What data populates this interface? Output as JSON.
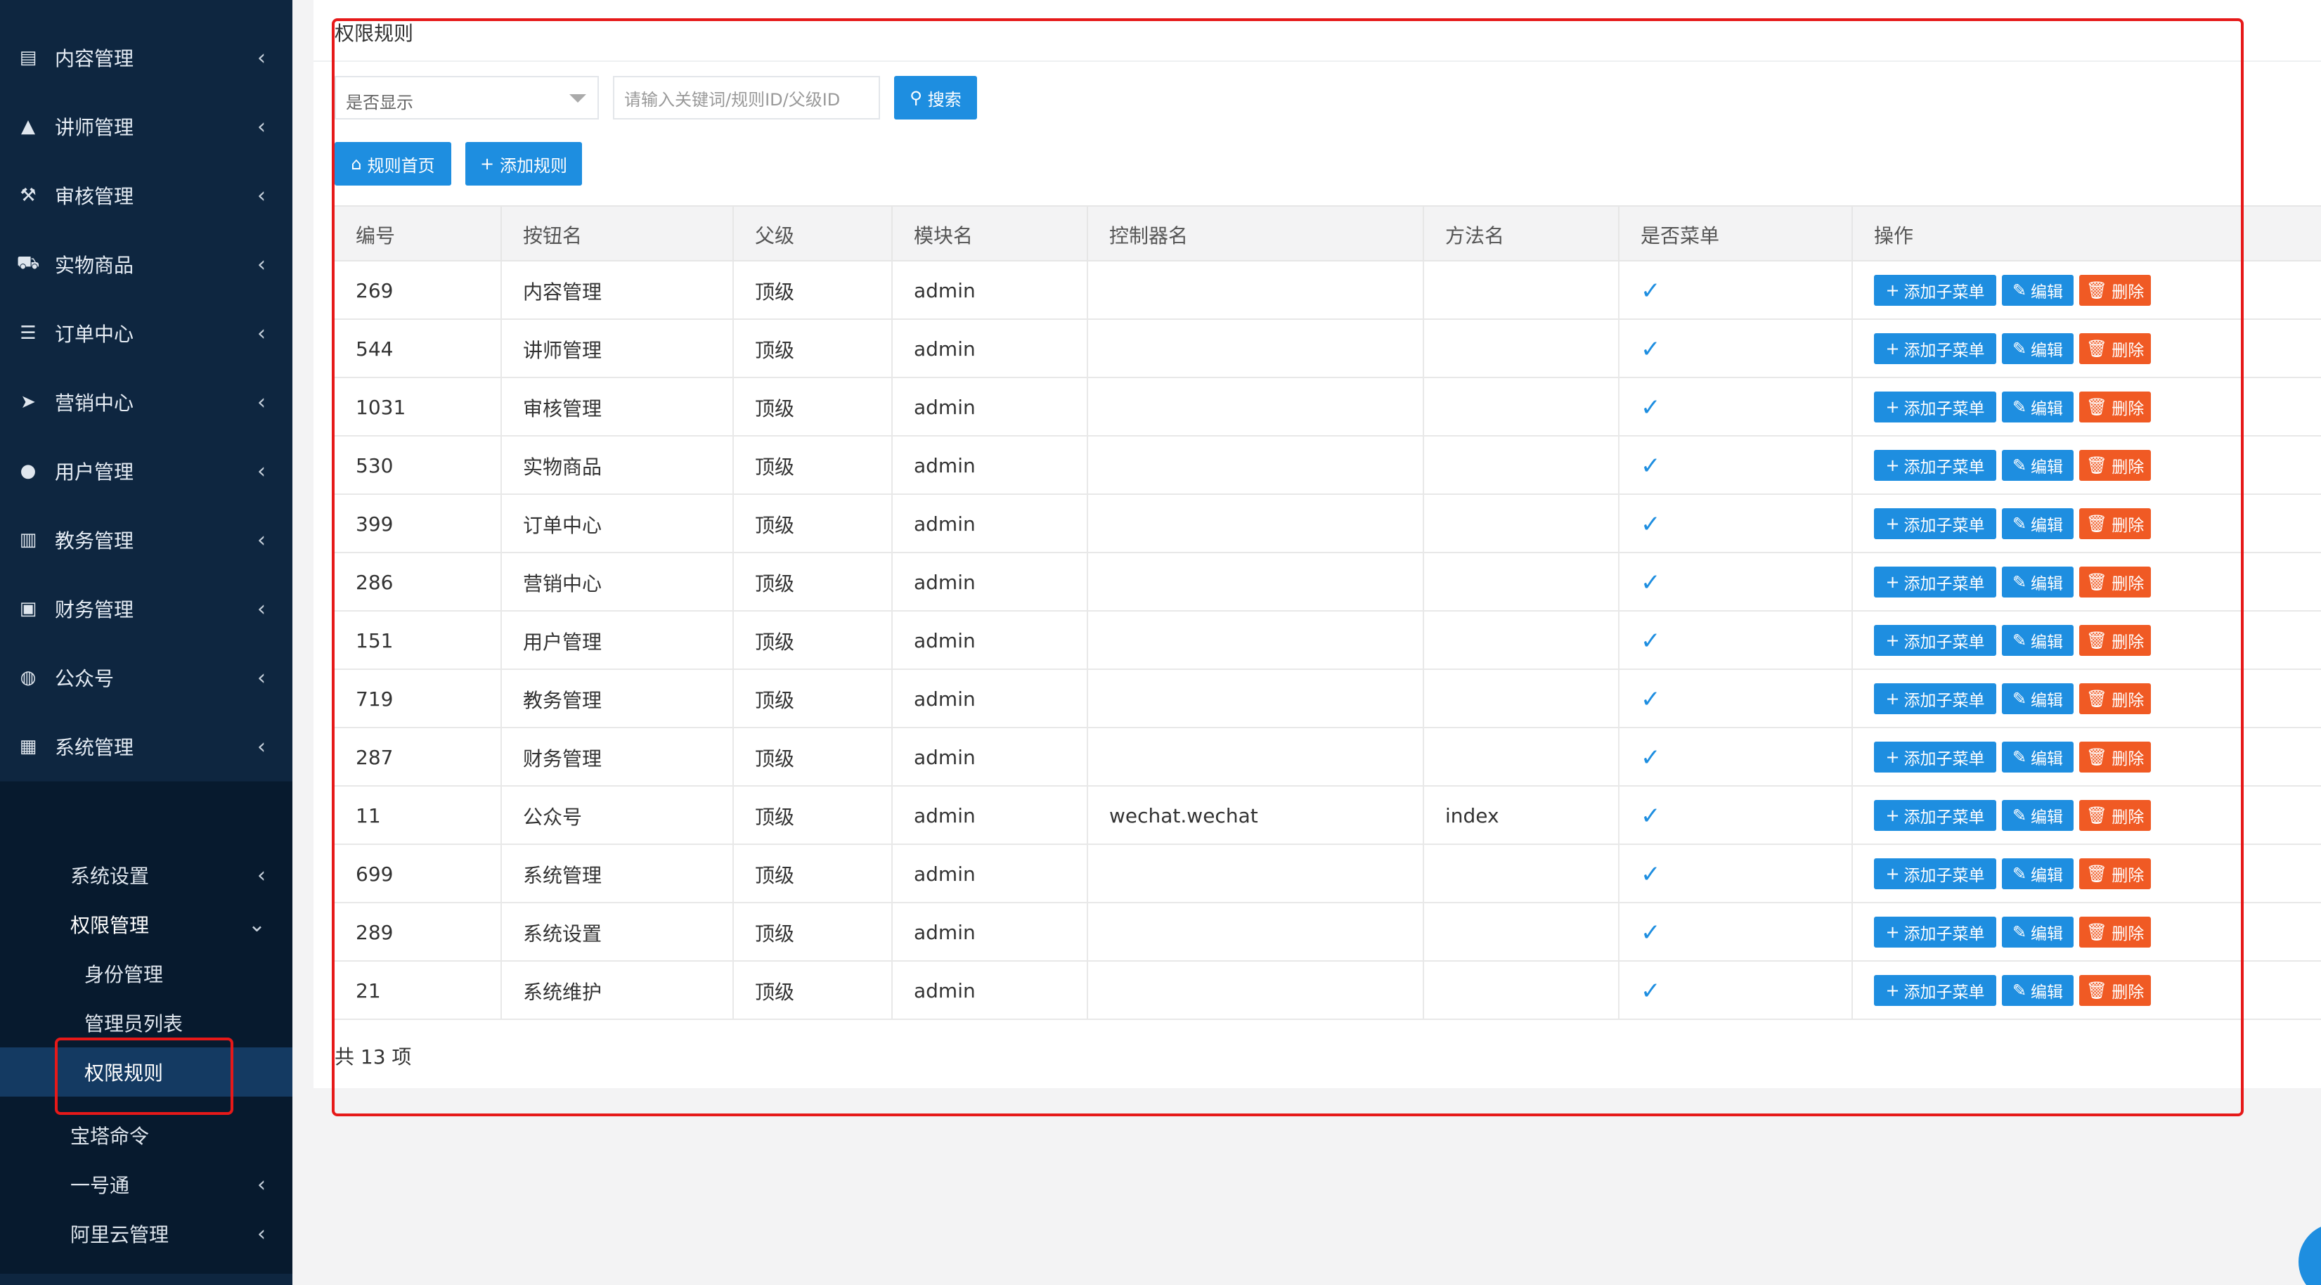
{
  "sidebar": {
    "items": [
      {
        "label": "内容管理",
        "icon": "newspaper-icon"
      },
      {
        "label": "讲师管理",
        "icon": "graduation-cap-icon"
      },
      {
        "label": "审核管理",
        "icon": "gavel-icon"
      },
      {
        "label": "实物商品",
        "icon": "cart-icon"
      },
      {
        "label": "订单中心",
        "icon": "list-icon"
      },
      {
        "label": "营销中心",
        "icon": "paper-plane-icon"
      },
      {
        "label": "用户管理",
        "icon": "user-icon"
      },
      {
        "label": "教务管理",
        "icon": "book-icon"
      },
      {
        "label": "财务管理",
        "icon": "money-icon"
      },
      {
        "label": "公众号",
        "icon": "wechat-icon"
      },
      {
        "label": "系统管理",
        "icon": "grid-icon"
      },
      {
        "label": "系统设置",
        "icon": "gear-icon"
      }
    ],
    "submenu": [
      {
        "label": "系统设置"
      },
      {
        "label": "权限管理"
      },
      {
        "label": "身份管理"
      },
      {
        "label": "管理员列表"
      },
      {
        "label": "权限规则"
      },
      {
        "label": "宝塔命令"
      },
      {
        "label": "一号通"
      },
      {
        "label": "阿里云管理"
      }
    ]
  },
  "card": {
    "title": "权限规则"
  },
  "filters": {
    "select_value": "是否显示",
    "search_placeholder": "请输入关键词/规则ID/父级ID",
    "search_label": "搜索"
  },
  "toolbar": {
    "home_label": "规则首页",
    "add_label": "添加规则"
  },
  "table": {
    "headers": [
      "编号",
      "按钮名",
      "父级",
      "模块名",
      "控制器名",
      "方法名",
      "是否菜单",
      "操作"
    ],
    "actions": {
      "add_child": "添加子菜单",
      "edit": "编辑",
      "delete": "删除"
    },
    "rows": [
      {
        "id": "269",
        "name": "内容管理",
        "parent": "顶级",
        "module": "admin",
        "controller": "",
        "method": ""
      },
      {
        "id": "544",
        "name": "讲师管理",
        "parent": "顶级",
        "module": "admin",
        "controller": "",
        "method": ""
      },
      {
        "id": "1031",
        "name": "审核管理",
        "parent": "顶级",
        "module": "admin",
        "controller": "",
        "method": ""
      },
      {
        "id": "530",
        "name": "实物商品",
        "parent": "顶级",
        "module": "admin",
        "controller": "",
        "method": ""
      },
      {
        "id": "399",
        "name": "订单中心",
        "parent": "顶级",
        "module": "admin",
        "controller": "",
        "method": ""
      },
      {
        "id": "286",
        "name": "营销中心",
        "parent": "顶级",
        "module": "admin",
        "controller": "",
        "method": ""
      },
      {
        "id": "151",
        "name": "用户管理",
        "parent": "顶级",
        "module": "admin",
        "controller": "",
        "method": ""
      },
      {
        "id": "719",
        "name": "教务管理",
        "parent": "顶级",
        "module": "admin",
        "controller": "",
        "method": ""
      },
      {
        "id": "287",
        "name": "财务管理",
        "parent": "顶级",
        "module": "admin",
        "controller": "",
        "method": ""
      },
      {
        "id": "11",
        "name": "公众号",
        "parent": "顶级",
        "module": "admin",
        "controller": "wechat.wechat",
        "method": "index"
      },
      {
        "id": "699",
        "name": "系统管理",
        "parent": "顶级",
        "module": "admin",
        "controller": "",
        "method": ""
      },
      {
        "id": "289",
        "name": "系统设置",
        "parent": "顶级",
        "module": "admin",
        "controller": "",
        "method": ""
      },
      {
        "id": "21",
        "name": "系统维护",
        "parent": "顶级",
        "module": "admin",
        "controller": "",
        "method": ""
      }
    ]
  },
  "footer": {
    "total": "共 13 项"
  },
  "colors": {
    "primary": "#1e8ee0",
    "danger": "#f05a24",
    "sidebar": "#0e2640",
    "annotation": "#e61919"
  }
}
